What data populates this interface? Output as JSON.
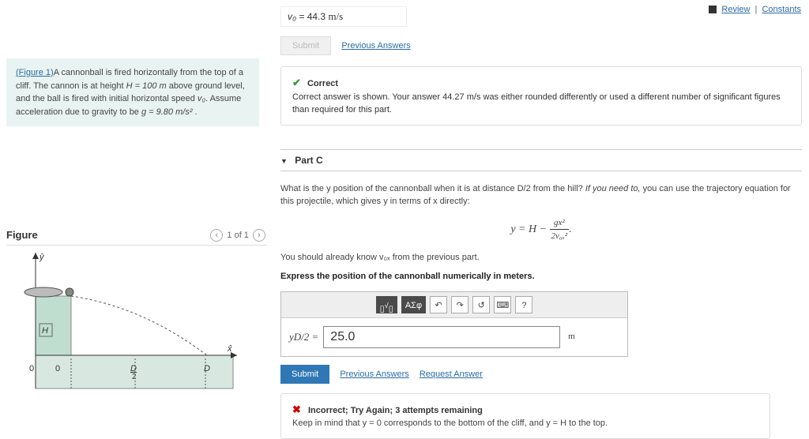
{
  "topLinks": {
    "review": "Review",
    "constants": "Constants"
  },
  "problem": {
    "figureLink": "(Figure 1)",
    "textA": "A cannonball is fired horizontally from the top of a cliff. The cannon is at height ",
    "H_eq": "H = 100 m",
    "textB": " above ground level, and the ball is fired with initial horizontal speed ",
    "v0": "v₀",
    "textC": ". Assume acceleration due to gravity to be ",
    "g_eq": "g = 9.80 m/s²",
    "textD": " ."
  },
  "figure": {
    "title": "Figure",
    "pager": "1 of 1"
  },
  "partB": {
    "prevLabel": "v₀ =",
    "prevValue": "44.3",
    "prevUnit": "m/s",
    "submit": "Submit",
    "previousAnswers": "Previous Answers",
    "correctTitle": "Correct",
    "correctBody": "Correct answer is shown. Your answer 44.27 m/s was either rounded differently or used a different number of significant figures than required for this part."
  },
  "partC": {
    "header": "Part C",
    "q1": "What is the y position of the cannonball when it is at distance D/2 from the hill? ",
    "hintLead": "If you need to,",
    "q2": " you can use the trajectory equation for this projectile, which gives y in terms of x directly:",
    "postEq": "You should already know v₀ₓ from the previous part.",
    "instr": "Express the position of the cannonball numerically in meters.",
    "toolbar": {
      "templ": "√",
      "greek": "ΑΣφ",
      "undo": "↶",
      "redo": "↷",
      "reset": "↺",
      "kbd": "⌨",
      "help": "?"
    },
    "lhs": "yD/2 =",
    "value": "25.0",
    "unit": "m",
    "submit": "Submit",
    "previousAnswers": "Previous Answers",
    "requestAnswer": "Request Answer",
    "wrongTitle": "Incorrect; Try Again; 3 attempts remaining",
    "wrongBody": "Keep in mind that y = 0 corresponds to the bottom of the cliff, and y = H to the top."
  }
}
